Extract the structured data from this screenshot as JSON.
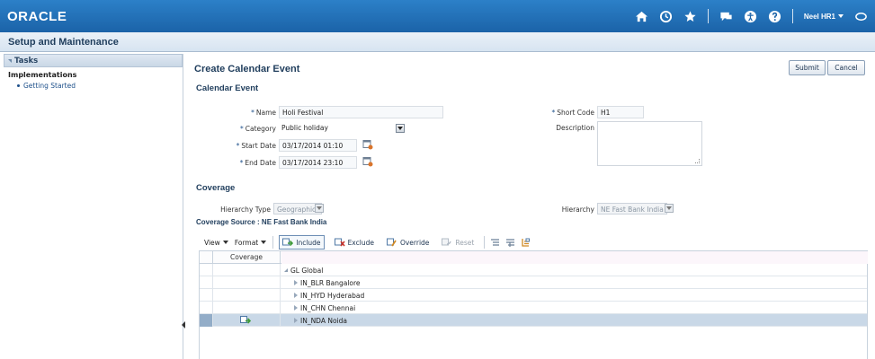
{
  "header": {
    "logo": "ORACLE",
    "user": "Neel HR1"
  },
  "titlebar": {
    "title": "Setup and Maintenance"
  },
  "left": {
    "tasks_label": "Tasks",
    "section": "Implementations",
    "items": [
      {
        "label": "Getting Started"
      }
    ]
  },
  "page": {
    "title": "Create Calendar Event",
    "submit": "Submit",
    "cancel": "Cancel"
  },
  "event": {
    "heading": "Calendar Event",
    "name_label": "Name",
    "name_value": "Holi Festival",
    "category_label": "Category",
    "category_value": "Public holiday",
    "start_label": "Start Date",
    "start_value": "03/17/2014 01:10",
    "end_label": "End Date",
    "end_value": "03/17/2014 23:10",
    "shortcode_label": "Short Code",
    "shortcode_value": "H1",
    "description_label": "Description",
    "description_value": ""
  },
  "coverage": {
    "heading": "Coverage",
    "hierarchy_type_label": "Hierarchy Type",
    "hierarchy_type_value": "Geographic",
    "hierarchy_label": "Hierarchy",
    "hierarchy_value": "NE Fast Bank India",
    "source_label": "Coverage Source : NE Fast Bank India"
  },
  "toolbar": {
    "view": "View",
    "format": "Format",
    "include": "Include",
    "exclude": "Exclude",
    "override": "Override",
    "reset": "Reset"
  },
  "table": {
    "col_coverage": "Coverage",
    "rows": [
      {
        "label": "GL Global"
      },
      {
        "label": "IN_BLR Bangalore"
      },
      {
        "label": "IN_HYD Hyderabad"
      },
      {
        "label": "IN_CHN Chennai"
      },
      {
        "label": "IN_NDA Noida"
      }
    ]
  },
  "colors": {
    "header_blue": "#1f6db6",
    "title_text": "#1f3d5c",
    "selected_row": "#c9d8e7"
  }
}
